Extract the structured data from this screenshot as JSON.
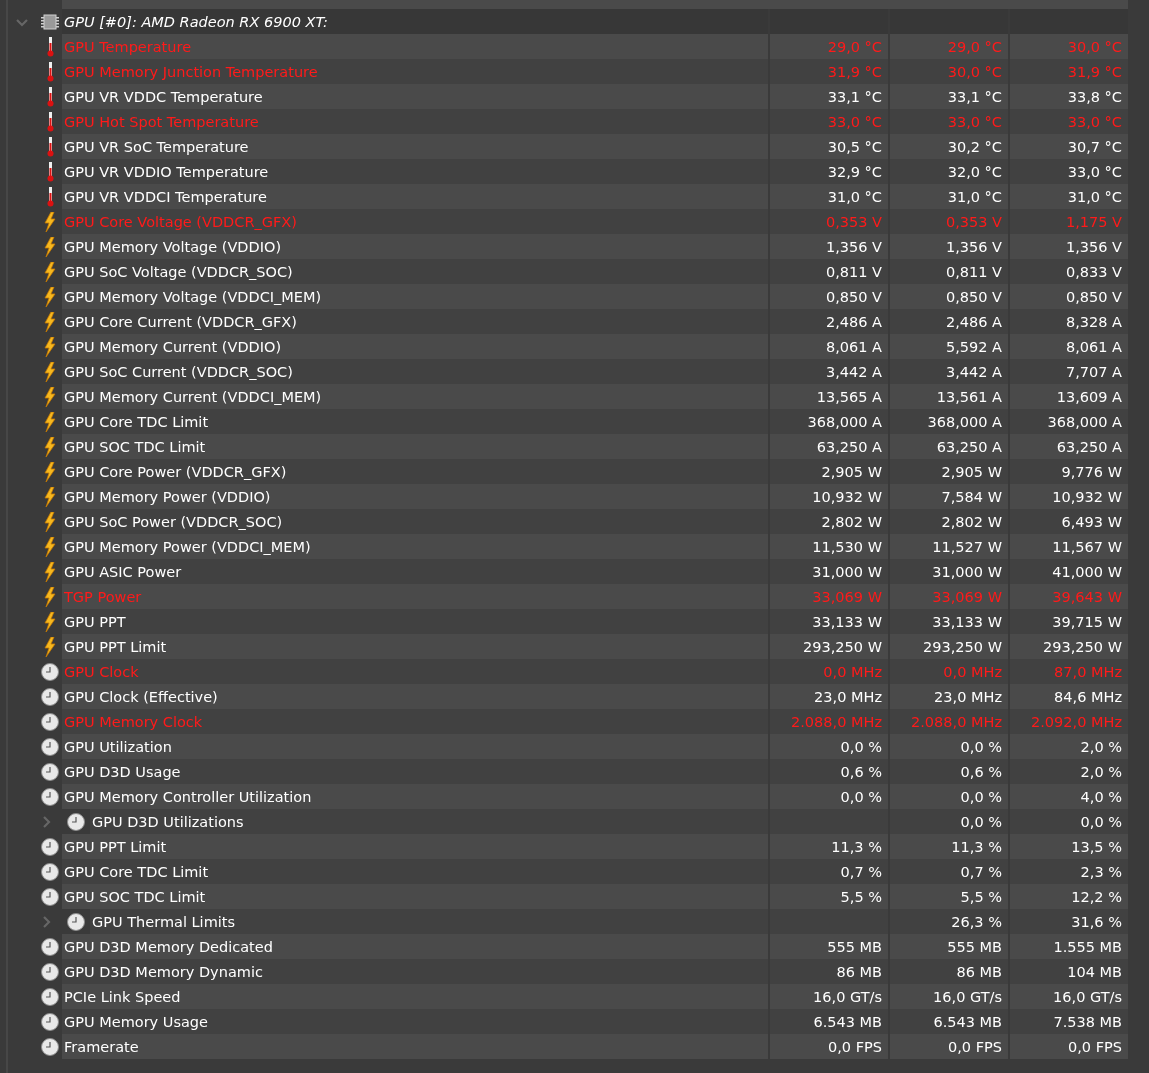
{
  "group": {
    "title": "GPU [#0]: AMD Radeon RX 6900 XT:",
    "expanded": true,
    "children": [
      {
        "kind": "temperature",
        "name": "GPU Temperature",
        "alert": true,
        "column_1": "29,0 °C",
        "column_2": "29,0 °C",
        "column_3": "30,0 °C"
      },
      {
        "kind": "temperature",
        "name": "GPU Memory Junction Temperature",
        "alert": true,
        "column_1": "31,9 °C",
        "column_2": "30,0 °C",
        "column_3": "31,9 °C"
      },
      {
        "kind": "temperature",
        "name": "GPU VR VDDC Temperature",
        "alert": false,
        "column_1": "33,1 °C",
        "column_2": "33,1 °C",
        "column_3": "33,8 °C"
      },
      {
        "kind": "temperature",
        "name": "GPU Hot Spot Temperature",
        "alert": true,
        "column_1": "33,0 °C",
        "column_2": "33,0 °C",
        "column_3": "33,0 °C"
      },
      {
        "kind": "temperature",
        "name": "GPU VR SoC Temperature",
        "alert": false,
        "column_1": "30,5 °C",
        "column_2": "30,2 °C",
        "column_3": "30,7 °C"
      },
      {
        "kind": "temperature",
        "name": "GPU VR VDDIO Temperature",
        "alert": false,
        "column_1": "32,9 °C",
        "column_2": "32,0 °C",
        "column_3": "33,0 °C"
      },
      {
        "kind": "temperature",
        "name": "GPU VR VDDCI Temperature",
        "alert": false,
        "column_1": "31,0 °C",
        "column_2": "31,0 °C",
        "column_3": "31,0 °C"
      },
      {
        "kind": "power",
        "name": "GPU Core Voltage (VDDCR_GFX)",
        "alert": true,
        "column_1": "0,353 V",
        "column_2": "0,353 V",
        "column_3": "1,175 V"
      },
      {
        "kind": "power",
        "name": "GPU Memory Voltage (VDDIO)",
        "alert": false,
        "column_1": "1,356 V",
        "column_2": "1,356 V",
        "column_3": "1,356 V"
      },
      {
        "kind": "power",
        "name": "GPU SoC Voltage (VDDCR_SOC)",
        "alert": false,
        "column_1": "0,811 V",
        "column_2": "0,811 V",
        "column_3": "0,833 V"
      },
      {
        "kind": "power",
        "name": "GPU Memory Voltage (VDDCI_MEM)",
        "alert": false,
        "column_1": "0,850 V",
        "column_2": "0,850 V",
        "column_3": "0,850 V"
      },
      {
        "kind": "power",
        "name": "GPU Core Current (VDDCR_GFX)",
        "alert": false,
        "column_1": "2,486 A",
        "column_2": "2,486 A",
        "column_3": "8,328 A"
      },
      {
        "kind": "power",
        "name": "GPU Memory Current (VDDIO)",
        "alert": false,
        "column_1": "8,061 A",
        "column_2": "5,592 A",
        "column_3": "8,061 A"
      },
      {
        "kind": "power",
        "name": "GPU SoC Current (VDDCR_SOC)",
        "alert": false,
        "column_1": "3,442 A",
        "column_2": "3,442 A",
        "column_3": "7,707 A"
      },
      {
        "kind": "power",
        "name": "GPU Memory Current (VDDCI_MEM)",
        "alert": false,
        "column_1": "13,565 A",
        "column_2": "13,561 A",
        "column_3": "13,609 A"
      },
      {
        "kind": "power",
        "name": "GPU Core TDC Limit",
        "alert": false,
        "column_1": "368,000 A",
        "column_2": "368,000 A",
        "column_3": "368,000 A"
      },
      {
        "kind": "power",
        "name": "GPU SOC TDC Limit",
        "alert": false,
        "column_1": "63,250 A",
        "column_2": "63,250 A",
        "column_3": "63,250 A"
      },
      {
        "kind": "power",
        "name": "GPU Core Power (VDDCR_GFX)",
        "alert": false,
        "column_1": "2,905 W",
        "column_2": "2,905 W",
        "column_3": "9,776 W"
      },
      {
        "kind": "power",
        "name": "GPU Memory Power (VDDIO)",
        "alert": false,
        "column_1": "10,932 W",
        "column_2": "7,584 W",
        "column_3": "10,932 W"
      },
      {
        "kind": "power",
        "name": "GPU SoC Power (VDDCR_SOC)",
        "alert": false,
        "column_1": "2,802 W",
        "column_2": "2,802 W",
        "column_3": "6,493 W"
      },
      {
        "kind": "power",
        "name": "GPU Memory Power (VDDCI_MEM)",
        "alert": false,
        "column_1": "11,530 W",
        "column_2": "11,527 W",
        "column_3": "11,567 W"
      },
      {
        "kind": "power",
        "name": "GPU ASIC Power",
        "alert": false,
        "column_1": "31,000 W",
        "column_2": "31,000 W",
        "column_3": "41,000 W"
      },
      {
        "kind": "power",
        "name": "TGP Power",
        "alert": true,
        "column_1": "33,069 W",
        "column_2": "33,069 W",
        "column_3": "39,643 W"
      },
      {
        "kind": "power",
        "name": "GPU PPT",
        "alert": false,
        "column_1": "33,133 W",
        "column_2": "33,133 W",
        "column_3": "39,715 W"
      },
      {
        "kind": "power",
        "name": "GPU PPT Limit",
        "alert": false,
        "column_1": "293,250 W",
        "column_2": "293,250 W",
        "column_3": "293,250 W"
      },
      {
        "kind": "other",
        "name": "GPU Clock",
        "alert": true,
        "column_1": "0,0 MHz",
        "column_2": "0,0 MHz",
        "column_3": "87,0 MHz"
      },
      {
        "kind": "other",
        "name": "GPU Clock (Effective)",
        "alert": false,
        "column_1": "23,0 MHz",
        "column_2": "23,0 MHz",
        "column_3": "84,6 MHz"
      },
      {
        "kind": "other",
        "name": "GPU Memory Clock",
        "alert": true,
        "column_1": "2.088,0 MHz",
        "column_2": "2.088,0 MHz",
        "column_3": "2.092,0 MHz"
      },
      {
        "kind": "other",
        "name": "GPU Utilization",
        "alert": false,
        "column_1": "0,0 %",
        "column_2": "0,0 %",
        "column_3": "2,0 %"
      },
      {
        "kind": "other",
        "name": "GPU D3D Usage",
        "alert": false,
        "column_1": "0,6 %",
        "column_2": "0,6 %",
        "column_3": "2,0 %"
      },
      {
        "kind": "other",
        "name": "GPU Memory Controller Utilization",
        "alert": false,
        "column_1": "0,0 %",
        "column_2": "0,0 %",
        "column_3": "4,0 %"
      },
      {
        "kind": "other",
        "name": "GPU D3D Utilizations",
        "alert": false,
        "expanded": false,
        "column_2": "0,0 %",
        "column_3": "0,0 %"
      },
      {
        "kind": "other",
        "name": "GPU PPT Limit",
        "alert": false,
        "column_1": "11,3 %",
        "column_2": "11,3 %",
        "column_3": "13,5 %"
      },
      {
        "kind": "other",
        "name": "GPU Core TDC Limit",
        "alert": false,
        "column_1": "0,7 %",
        "column_2": "0,7 %",
        "column_3": "2,3 %"
      },
      {
        "kind": "other",
        "name": "GPU SOC TDC Limit",
        "alert": false,
        "column_1": "5,5 %",
        "column_2": "5,5 %",
        "column_3": "12,2 %"
      },
      {
        "kind": "other",
        "name": "GPU Thermal Limits",
        "alert": false,
        "expanded": false,
        "column_2": "26,3 %",
        "column_3": "31,6 %"
      },
      {
        "kind": "other",
        "name": "GPU D3D Memory Dedicated",
        "alert": false,
        "column_1": "555 MB",
        "column_2": "555 MB",
        "column_3": "1.555 MB"
      },
      {
        "kind": "other",
        "name": "GPU D3D Memory Dynamic",
        "alert": false,
        "column_1": "86 MB",
        "column_2": "86 MB",
        "column_3": "104 MB"
      },
      {
        "kind": "other",
        "name": "PCIe Link Speed",
        "alert": false,
        "column_1": "16,0 GT/s",
        "column_2": "16,0 GT/s",
        "column_3": "16,0 GT/s"
      },
      {
        "kind": "other",
        "name": "GPU Memory Usage",
        "alert": false,
        "column_1": "6.543 MB",
        "column_2": "6.543 MB",
        "column_3": "7.538 MB"
      },
      {
        "kind": "other",
        "name": "Framerate",
        "alert": false,
        "column_1": "0,0 FPS",
        "column_2": "0,0 FPS",
        "column_3": "0,0 FPS"
      }
    ]
  }
}
